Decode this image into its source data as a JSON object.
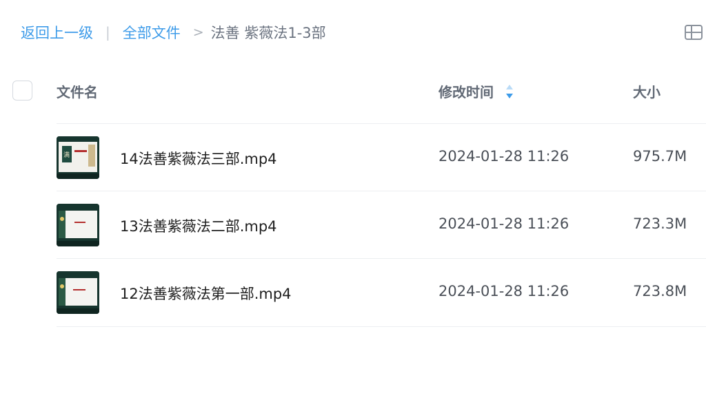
{
  "breadcrumb": {
    "back_label": "返回上一级",
    "root_label": "全部文件",
    "separator": ">",
    "current_folder": "法善 紫薇法1-3部"
  },
  "view_toggle": {
    "icon": "grid-view-icon"
  },
  "table": {
    "headers": {
      "name": "文件名",
      "modified": "修改时间",
      "size": "大小"
    },
    "sort_icon": "sort-icon",
    "accent_color": "#3d9be9",
    "rows": [
      {
        "name": "14法善紫薇法三部.mp4",
        "modified": "2024-01-28 11:26",
        "size": "975.7M",
        "thumbnail_icon": "video-thumbnail"
      },
      {
        "name": "13法善紫薇法二部.mp4",
        "modified": "2024-01-28 11:26",
        "size": "723.3M",
        "thumbnail_icon": "video-thumbnail"
      },
      {
        "name": "12法善紫薇法第一部.mp4",
        "modified": "2024-01-28 11:26",
        "size": "723.8M",
        "thumbnail_icon": "video-thumbnail"
      }
    ]
  }
}
